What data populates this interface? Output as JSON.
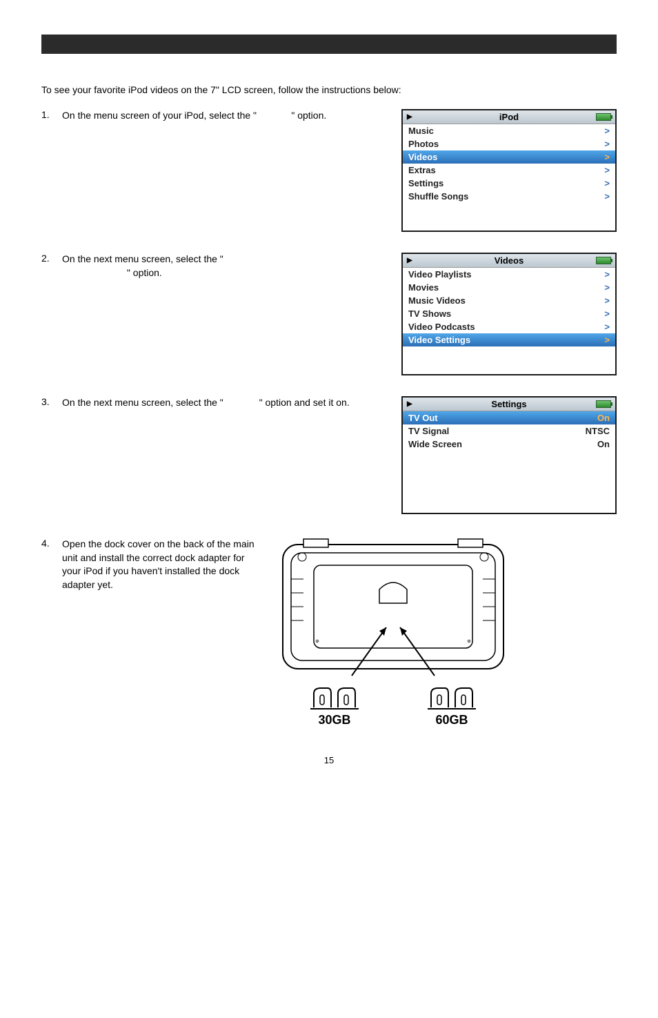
{
  "intro": "To see your favorite iPod videos on the 7\" LCD screen, follow the instructions below:",
  "steps": {
    "s1": {
      "num": "1.",
      "text_a": "On the menu screen of your iPod, select the \"",
      "text_b": "\" option."
    },
    "s2": {
      "num": "2.",
      "text_a": "On the next menu screen, select the \"",
      "text_b": "\" option."
    },
    "s3": {
      "num": "3.",
      "text_a": "On the next menu screen, select the \"",
      "text_b": "\" option and set it on."
    },
    "s4": {
      "num": "4.",
      "text": "Open the dock cover on the back of the main unit and install the correct dock adapter for your iPod if you haven't installed the dock adapter yet."
    }
  },
  "ipod1": {
    "title": "iPod",
    "items": [
      {
        "label": "Music",
        "selected": false
      },
      {
        "label": "Photos",
        "selected": false
      },
      {
        "label": "Videos",
        "selected": true
      },
      {
        "label": "Extras",
        "selected": false
      },
      {
        "label": "Settings",
        "selected": false
      },
      {
        "label": "Shuffle Songs",
        "selected": false
      }
    ]
  },
  "ipod2": {
    "title": "Videos",
    "items": [
      {
        "label": "Video Playlists",
        "selected": false
      },
      {
        "label": "Movies",
        "selected": false
      },
      {
        "label": "Music Videos",
        "selected": false
      },
      {
        "label": "TV Shows",
        "selected": false
      },
      {
        "label": "Video Podcasts",
        "selected": false
      },
      {
        "label": "Video Settings",
        "selected": true
      }
    ]
  },
  "ipod3": {
    "title": "Settings",
    "items": [
      {
        "label": "TV Out",
        "value": "On",
        "selected": true
      },
      {
        "label": "TV Signal",
        "value": "NTSC",
        "selected": false
      },
      {
        "label": "Wide Screen",
        "value": "On",
        "selected": false
      }
    ]
  },
  "adapters": {
    "a": "30GB",
    "b": "60GB"
  },
  "page_number": "15"
}
